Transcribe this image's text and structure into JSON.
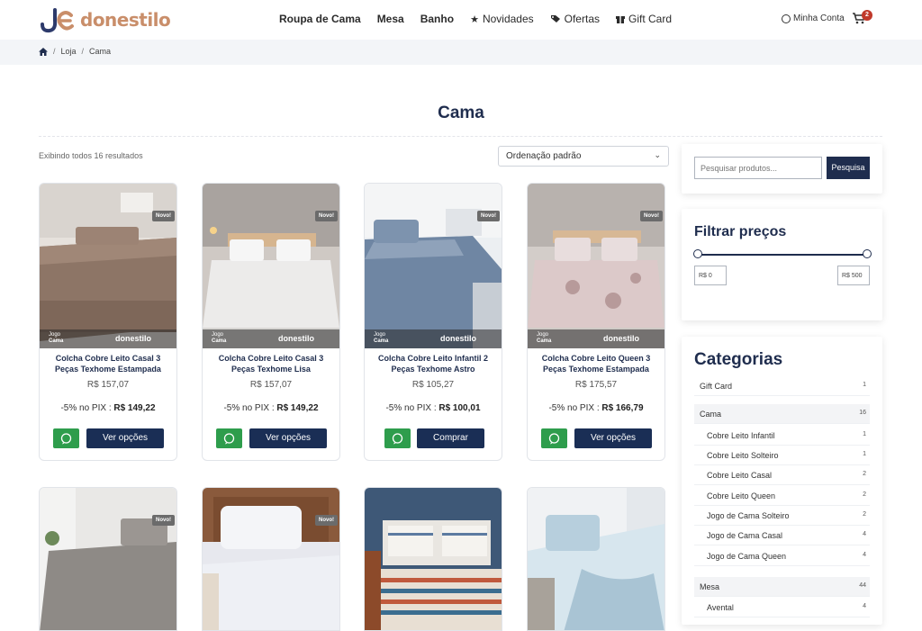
{
  "brand": {
    "name": "donestilo"
  },
  "nav": {
    "items": [
      {
        "label": "Roupa de Cama",
        "bold": true
      },
      {
        "label": "Mesa",
        "bold": true
      },
      {
        "label": "Banho",
        "bold": true
      },
      {
        "label": "Novidades",
        "icon": "star-icon"
      },
      {
        "label": "Ofertas",
        "icon": "tags-icon"
      },
      {
        "label": "Gift Card",
        "icon": "gift-icon"
      }
    ],
    "account": "Minha Conta",
    "cart_count": "2"
  },
  "breadcrumb": {
    "items": [
      "Loja",
      "Cama"
    ]
  },
  "page": {
    "title": "Cama",
    "results": "Exibindo todos 16 resultados",
    "sort": "Ordenação padrão"
  },
  "products": [
    {
      "name": "Colcha Cobre Leito Casal 3 Peças Texhome Estampada",
      "price": "R$ 157,07",
      "pix_prefix": "-5% no PIX : ",
      "pix": "R$ 149,22",
      "button": "Ver opções",
      "badge": "Novo!",
      "jogo": "Jogo",
      "jogo2": "Cama",
      "img_brand": "donestilo"
    },
    {
      "name": "Colcha Cobre Leito Casal 3 Peças Texhome Lisa",
      "price": "R$ 157,07",
      "pix_prefix": "-5% no PIX : ",
      "pix": "R$ 149,22",
      "button": "Ver opções",
      "badge": "Novo!",
      "jogo": "Jogo",
      "jogo2": "Cama",
      "img_brand": "donestilo"
    },
    {
      "name": "Colcha Cobre Leito Infantil 2 Peças Texhome Astro",
      "price": "R$ 105,27",
      "pix_prefix": "-5% no PIX : ",
      "pix": "R$ 100,01",
      "button": "Comprar",
      "badge": "Novo!",
      "jogo": "Jogo",
      "jogo2": "Cama",
      "img_brand": "donestilo"
    },
    {
      "name": "Colcha Cobre Leito Queen 3 Peças Texhome Estampada",
      "price": "R$ 175,57",
      "pix_prefix": "-5% no PIX : ",
      "pix": "R$ 166,79",
      "button": "Ver opções",
      "badge": "Novo!",
      "jogo": "Jogo",
      "jogo2": "Cama",
      "img_brand": "donestilo"
    }
  ],
  "products_row2": [
    {
      "badge": "Novo!"
    },
    {
      "badge": "Novo!"
    },
    {
      "badge": ""
    },
    {
      "badge": ""
    }
  ],
  "sidebar": {
    "search_placeholder": "Pesquisar produtos...",
    "search_button": "Pesquisa",
    "filter_title": "Filtrar preços",
    "price_min": "R$ 0",
    "price_max": "R$ 500",
    "categories_title": "Categorias",
    "categories": [
      {
        "label": "Gift Card",
        "count": "1",
        "top": false,
        "indent": false
      },
      {
        "label": "Cama",
        "count": "16",
        "top": true,
        "indent": false
      },
      {
        "label": "Cobre Leito Infantil",
        "count": "1",
        "top": false,
        "indent": true
      },
      {
        "label": "Cobre Leito Solteiro",
        "count": "1",
        "top": false,
        "indent": true
      },
      {
        "label": "Cobre Leito Casal",
        "count": "2",
        "top": false,
        "indent": true
      },
      {
        "label": "Cobre Leito Queen",
        "count": "2",
        "top": false,
        "indent": true
      },
      {
        "label": "Jogo de Cama Solteiro",
        "count": "2",
        "top": false,
        "indent": true
      },
      {
        "label": "Jogo de Cama Casal",
        "count": "4",
        "top": false,
        "indent": true
      },
      {
        "label": "Jogo de Cama Queen",
        "count": "4",
        "top": false,
        "indent": true
      },
      {
        "label": "Mesa",
        "count": "44",
        "top": true,
        "indent": false
      },
      {
        "label": "Avental",
        "count": "4",
        "top": false,
        "indent": true
      }
    ]
  },
  "colors": {
    "navy": "#1f2d4e",
    "button": "#1a2e55",
    "whatsapp": "#2e9d4c",
    "brand_copper": "#c98e6a",
    "cart_badge": "#c0392b"
  }
}
